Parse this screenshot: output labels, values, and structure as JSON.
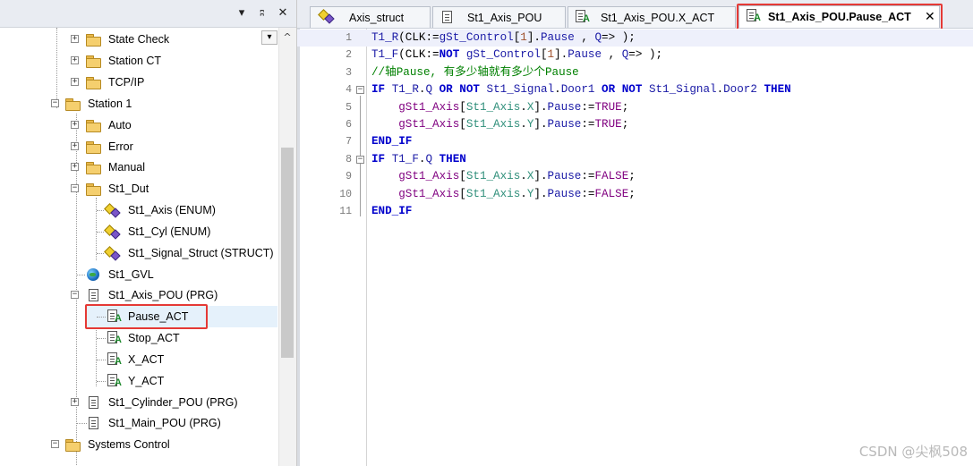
{
  "panel_toolbar": {
    "dropdown_glyph": "▾",
    "pin_glyph": "ᵖ",
    "close_glyph": "✕",
    "icons": [
      "dropdown-icon",
      "pin-icon",
      "close-icon"
    ]
  },
  "tree": {
    "items": [
      {
        "label": "State Check",
        "expander": "+"
      },
      {
        "label": "Station CT",
        "expander": "+"
      },
      {
        "label": "TCP/IP",
        "expander": "+"
      },
      {
        "label": "Station 1",
        "expander": "−"
      },
      {
        "label": "Auto",
        "expander": "+"
      },
      {
        "label": "Error",
        "expander": "+"
      },
      {
        "label": "Manual",
        "expander": "+"
      },
      {
        "label": "St1_Dut",
        "expander": "−"
      },
      {
        "label": "St1_Axis (ENUM)"
      },
      {
        "label": "St1_Cyl (ENUM)"
      },
      {
        "label": "St1_Signal_Struct (STRUCT)"
      },
      {
        "label": "St1_GVL"
      },
      {
        "label": "St1_Axis_POU (PRG)",
        "expander": "−"
      },
      {
        "label": "Pause_ACT",
        "selected": true
      },
      {
        "label": "Stop_ACT"
      },
      {
        "label": "X_ACT"
      },
      {
        "label": "Y_ACT"
      },
      {
        "label": "St1_Cylinder_POU (PRG)",
        "expander": "+"
      },
      {
        "label": "St1_Main_POU (PRG)"
      },
      {
        "label": "Systems Control",
        "expander": "−"
      }
    ],
    "scroll_buttons": {
      "dropdown": "▾",
      "up": "^"
    }
  },
  "tabs": [
    {
      "label": "Axis_struct",
      "icon": "struct-icon"
    },
    {
      "label": "St1_Axis_POU",
      "icon": "pou-icon"
    },
    {
      "label": "St1_Axis_POU.X_ACT",
      "icon": "action-icon"
    },
    {
      "label": "St1_Axis_POU.Pause_ACT",
      "icon": "action-icon",
      "active": true,
      "close": "✕"
    }
  ],
  "code": {
    "line_numbers": [
      "1",
      "2",
      "3",
      "4",
      "5",
      "6",
      "7",
      "8",
      "9",
      "10",
      "11"
    ],
    "fold_glyph": "−",
    "lines": [
      [
        [
          "id",
          "T1_R"
        ],
        [
          "op",
          "(CLK:="
        ],
        [
          "id",
          "gSt_Control"
        ],
        [
          "op",
          "["
        ],
        [
          "num",
          "1"
        ],
        [
          "op",
          "]."
        ],
        [
          "id",
          "Pause"
        ],
        [
          "op",
          " , "
        ],
        [
          "id",
          "Q"
        ],
        [
          "op",
          "=> );"
        ]
      ],
      [
        [
          "id",
          "T1_F"
        ],
        [
          "op",
          "(CLK:="
        ],
        [
          "kw",
          "NOT"
        ],
        [
          "op",
          " "
        ],
        [
          "id",
          "gSt_Control"
        ],
        [
          "op",
          "["
        ],
        [
          "num",
          "1"
        ],
        [
          "op",
          "]."
        ],
        [
          "id",
          "Pause"
        ],
        [
          "op",
          " , "
        ],
        [
          "id",
          "Q"
        ],
        [
          "op",
          "=> );"
        ]
      ],
      [
        [
          "cm",
          "//轴Pause, 有多少轴就有多少个Pause"
        ]
      ],
      [
        [
          "kw",
          "IF"
        ],
        [
          "op",
          " "
        ],
        [
          "id",
          "T1_R"
        ],
        [
          "op",
          "."
        ],
        [
          "id",
          "Q"
        ],
        [
          "op",
          " "
        ],
        [
          "kw",
          "OR"
        ],
        [
          "op",
          " "
        ],
        [
          "kw",
          "NOT"
        ],
        [
          "op",
          " "
        ],
        [
          "id",
          "St1_Signal"
        ],
        [
          "op",
          "."
        ],
        [
          "id",
          "Door1"
        ],
        [
          "op",
          " "
        ],
        [
          "kw",
          "OR"
        ],
        [
          "op",
          " "
        ],
        [
          "kw",
          "NOT"
        ],
        [
          "op",
          " "
        ],
        [
          "id",
          "St1_Signal"
        ],
        [
          "op",
          "."
        ],
        [
          "id",
          "Door2"
        ],
        [
          "op",
          " "
        ],
        [
          "kw",
          "THEN"
        ]
      ],
      [
        [
          "op",
          "    "
        ],
        [
          "lit",
          "gSt1_Axis"
        ],
        [
          "op",
          "["
        ],
        [
          "en",
          "St1_Axis"
        ],
        [
          "op",
          "."
        ],
        [
          "en",
          "X"
        ],
        [
          "op",
          "]."
        ],
        [
          "id",
          "Pause"
        ],
        [
          "op",
          ":="
        ],
        [
          "lit",
          "TRUE"
        ],
        [
          "op",
          ";"
        ]
      ],
      [
        [
          "op",
          "    "
        ],
        [
          "lit",
          "gSt1_Axis"
        ],
        [
          "op",
          "["
        ],
        [
          "en",
          "St1_Axis"
        ],
        [
          "op",
          "."
        ],
        [
          "en",
          "Y"
        ],
        [
          "op",
          "]."
        ],
        [
          "id",
          "Pause"
        ],
        [
          "op",
          ":="
        ],
        [
          "lit",
          "TRUE"
        ],
        [
          "op",
          ";"
        ]
      ],
      [
        [
          "kw",
          "END_IF"
        ]
      ],
      [
        [
          "kw",
          "IF"
        ],
        [
          "op",
          " "
        ],
        [
          "id",
          "T1_F"
        ],
        [
          "op",
          "."
        ],
        [
          "id",
          "Q"
        ],
        [
          "op",
          " "
        ],
        [
          "kw",
          "THEN"
        ]
      ],
      [
        [
          "op",
          "    "
        ],
        [
          "lit",
          "gSt1_Axis"
        ],
        [
          "op",
          "["
        ],
        [
          "en",
          "St1_Axis"
        ],
        [
          "op",
          "."
        ],
        [
          "en",
          "X"
        ],
        [
          "op",
          "]."
        ],
        [
          "id",
          "Pause"
        ],
        [
          "op",
          ":="
        ],
        [
          "lit",
          "FALSE"
        ],
        [
          "op",
          ";"
        ]
      ],
      [
        [
          "op",
          "    "
        ],
        [
          "lit",
          "gSt1_Axis"
        ],
        [
          "op",
          "["
        ],
        [
          "en",
          "St1_Axis"
        ],
        [
          "op",
          "."
        ],
        [
          "en",
          "Y"
        ],
        [
          "op",
          "]."
        ],
        [
          "id",
          "Pause"
        ],
        [
          "op",
          ":="
        ],
        [
          "lit",
          "FALSE"
        ],
        [
          "op",
          ";"
        ]
      ],
      [
        [
          "kw",
          "END_IF"
        ]
      ]
    ]
  },
  "watermark": "CSDN @尖枫508",
  "colors": {
    "keyword": "#0000cc",
    "literal": "#800080",
    "comment": "#008000",
    "highlight_box": "#e53935",
    "selection": "#e5f1fb"
  }
}
